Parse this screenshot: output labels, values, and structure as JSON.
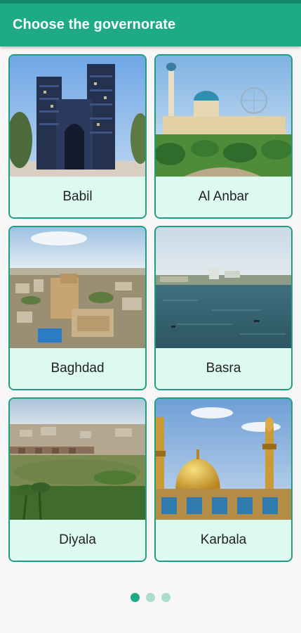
{
  "app_bar": {
    "title": "Choose the governorate"
  },
  "governorates": [
    {
      "label": "Babil",
      "image": "ishtar-gate-photo"
    },
    {
      "label": "Al Anbar",
      "image": "mosque-park-photo"
    },
    {
      "label": "Baghdad",
      "image": "city-aerial-photo"
    },
    {
      "label": "Basra",
      "image": "river-waterfront-photo"
    },
    {
      "label": "Diyala",
      "image": "river-bridge-town-photo"
    },
    {
      "label": "Karbala",
      "image": "golden-dome-shrine-photo"
    }
  ],
  "pager": {
    "page_count": 3,
    "active_index": 0
  },
  "colors": {
    "primary": "#1faa86",
    "card_bg": "#dcfaef",
    "card_border": "#1e9e7e"
  }
}
